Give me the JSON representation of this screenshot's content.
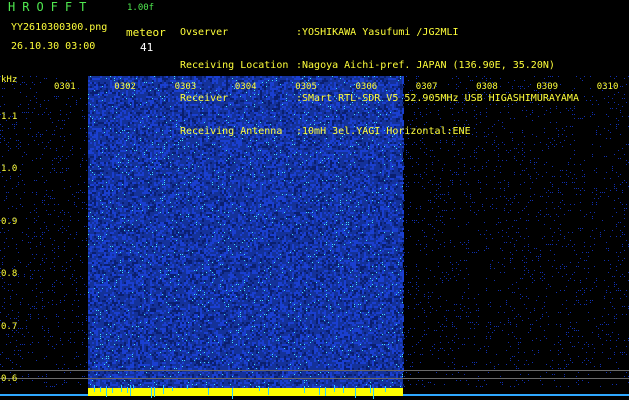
{
  "header": {
    "brand": "HROFFT",
    "version": "1.00f",
    "filename": "YY2610300300.png",
    "datetime": "26.10.30 03:00",
    "meteor_label": "meteor",
    "meteor_count": "41"
  },
  "meta": [
    {
      "key": "Ovserver",
      "value": ":YOSHIKAWA Yasufumi /JG2MLI"
    },
    {
      "key": "Receiving Location",
      "value": ":Nagoya Aichi-pref. JAPAN (136.90E, 35.20N)"
    },
    {
      "key": "Receiver",
      "value": ":SMart RTL-SDR V5 52.905MHz USB HIGASHIMURAYAMA"
    },
    {
      "key": "Receiving Antenna",
      "value": ":10mH 3el.YAGI Horizontal:ENE"
    }
  ],
  "spectrogram": {
    "y_unit": "kHz",
    "y_ticks": [
      "1.1",
      "1.0",
      "0.9",
      "0.8",
      "0.7",
      "0.6"
    ],
    "y_tick_values": [
      1.1,
      1.0,
      0.9,
      0.8,
      0.7,
      0.6
    ],
    "y_range": [
      0.57,
      1.18
    ],
    "x_labels": [
      "0301",
      "0302",
      "0303",
      "0304",
      "0305",
      "0306",
      "0307",
      "0308",
      "0309",
      "0310"
    ],
    "colors": {
      "background": "#000000",
      "dense_noise": "#1a3fd0",
      "sparse_noise": "#1030b0",
      "speckle": "#3fe0ff",
      "baseline_bar": "#ffff00",
      "axis_text": "#ffff3a"
    }
  }
}
